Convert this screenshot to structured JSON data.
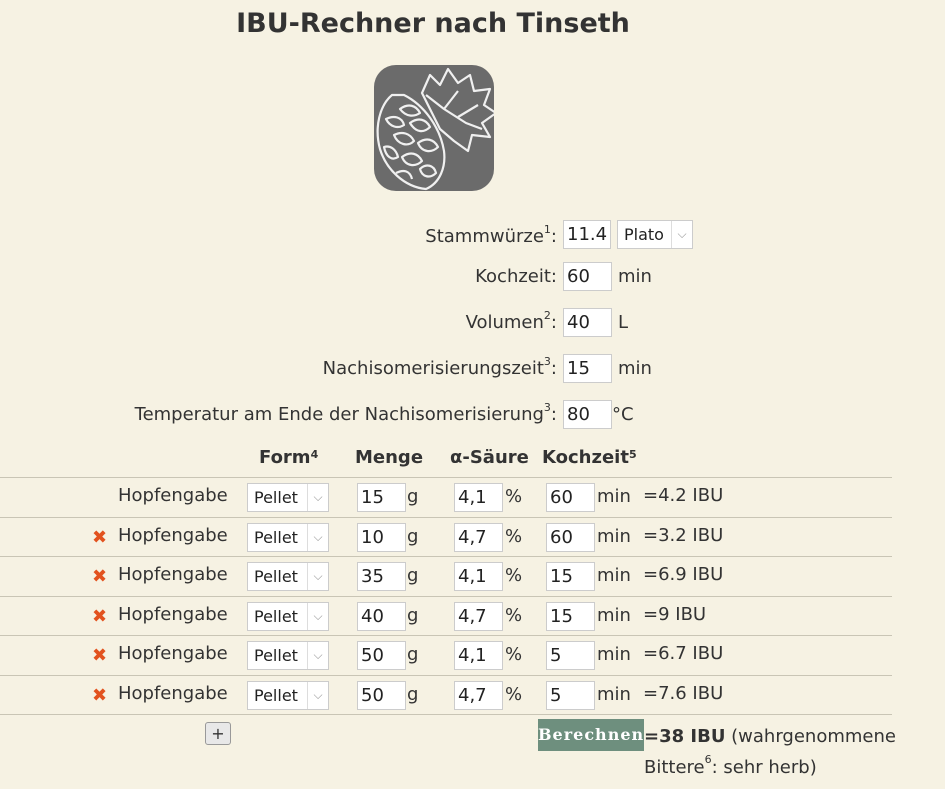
{
  "title": "IBU-Rechner nach Tinseth",
  "logo": "hop-cone-logo",
  "params": {
    "stammwuerze": {
      "label": "Stammwürze",
      "note": "1",
      "suffix": ":",
      "value": "11.4",
      "unit_select": "Plato"
    },
    "kochzeit": {
      "label": "Kochzeit:",
      "value": "60",
      "unit": "min"
    },
    "volumen": {
      "label": "Volumen",
      "note": "2",
      "suffix": ":",
      "value": "40",
      "unit": "L"
    },
    "nachiso": {
      "label": "Nachisomerisierungszeit",
      "note": "3",
      "suffix": ":",
      "value": "15",
      "unit": "min"
    },
    "temperatur": {
      "label": "Temperatur am Ende der Nachisomerisierung",
      "note": "3",
      "suffix": ":",
      "value": "80",
      "unit": "°C"
    }
  },
  "headers": {
    "form": "Form",
    "form_note": "4",
    "menge": "Menge",
    "alpha": "α-Säure",
    "kochzeit": "Kochzeit",
    "kochzeit_note": "5"
  },
  "hops": [
    {
      "remove": false,
      "name": "Hopfengabe",
      "form": "Pellet",
      "menge": "15",
      "menge_unit": "g",
      "alpha": "4,1",
      "alpha_unit": "%",
      "kochzeit": "60",
      "kochzeit_unit": "min",
      "ibu": "=4.2 IBU"
    },
    {
      "remove": true,
      "name": "Hopfengabe",
      "form": "Pellet",
      "menge": "10",
      "menge_unit": "g",
      "alpha": "4,7",
      "alpha_unit": "%",
      "kochzeit": "60",
      "kochzeit_unit": "min",
      "ibu": "=3.2 IBU"
    },
    {
      "remove": true,
      "name": "Hopfengabe",
      "form": "Pellet",
      "menge": "35",
      "menge_unit": "g",
      "alpha": "4,1",
      "alpha_unit": "%",
      "kochzeit": "15",
      "kochzeit_unit": "min",
      "ibu": "=6.9 IBU"
    },
    {
      "remove": true,
      "name": "Hopfengabe",
      "form": "Pellet",
      "menge": "40",
      "menge_unit": "g",
      "alpha": "4,7",
      "alpha_unit": "%",
      "kochzeit": "15",
      "kochzeit_unit": "min",
      "ibu": "=9 IBU"
    },
    {
      "remove": true,
      "name": "Hopfengabe",
      "form": "Pellet",
      "menge": "50",
      "menge_unit": "g",
      "alpha": "4,1",
      "alpha_unit": "%",
      "kochzeit": "5",
      "kochzeit_unit": "min",
      "ibu": "=6.7 IBU"
    },
    {
      "remove": true,
      "name": "Hopfengabe",
      "form": "Pellet",
      "menge": "50",
      "menge_unit": "g",
      "alpha": "4,7",
      "alpha_unit": "%",
      "kochzeit": "5",
      "kochzeit_unit": "min",
      "ibu": "=7.6 IBU"
    }
  ],
  "add_label": "+",
  "remove_glyph": "✖",
  "calc_label": "Berechnen",
  "result": {
    "total": "=38 IBU",
    "text1": " (wahrgenommene Bittere",
    "note": "6",
    "text2": ": sehr herb)"
  },
  "colors": {
    "background": "#f6f2e3",
    "button": "#6e8f7e",
    "remove": "#e2521e"
  }
}
